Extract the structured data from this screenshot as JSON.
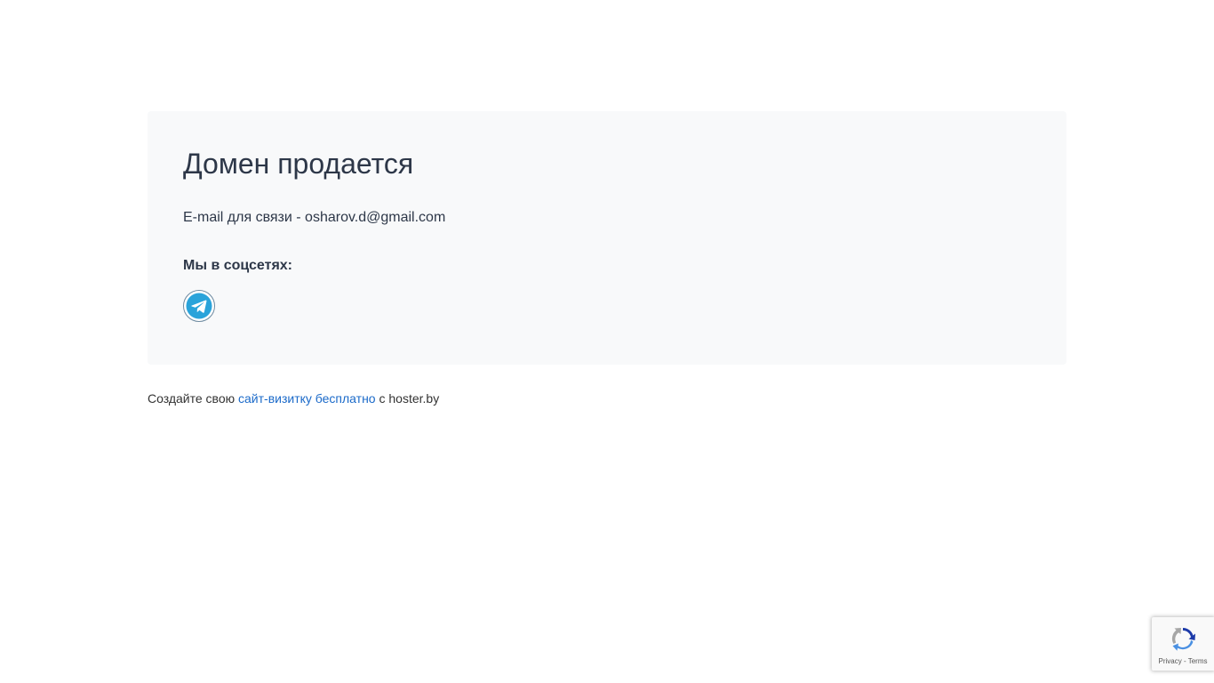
{
  "main": {
    "title": "Домен продается",
    "contact_text": "E-mail для связи - osharov.d@gmail.com",
    "social_heading": "Мы в соцсетях:",
    "social_icon": "telegram-icon"
  },
  "footer": {
    "prefix": "Создайте свою",
    "link_text": "сайт-визитку бесплатно",
    "suffix": "с hoster.by"
  },
  "recaptcha": {
    "links": "Privacy - Terms"
  },
  "colors": {
    "card_background": "#f8f9fa",
    "title_text": "#2d3748",
    "link": "#1b6ac9",
    "telegram_blue": "#2AA3DA"
  }
}
